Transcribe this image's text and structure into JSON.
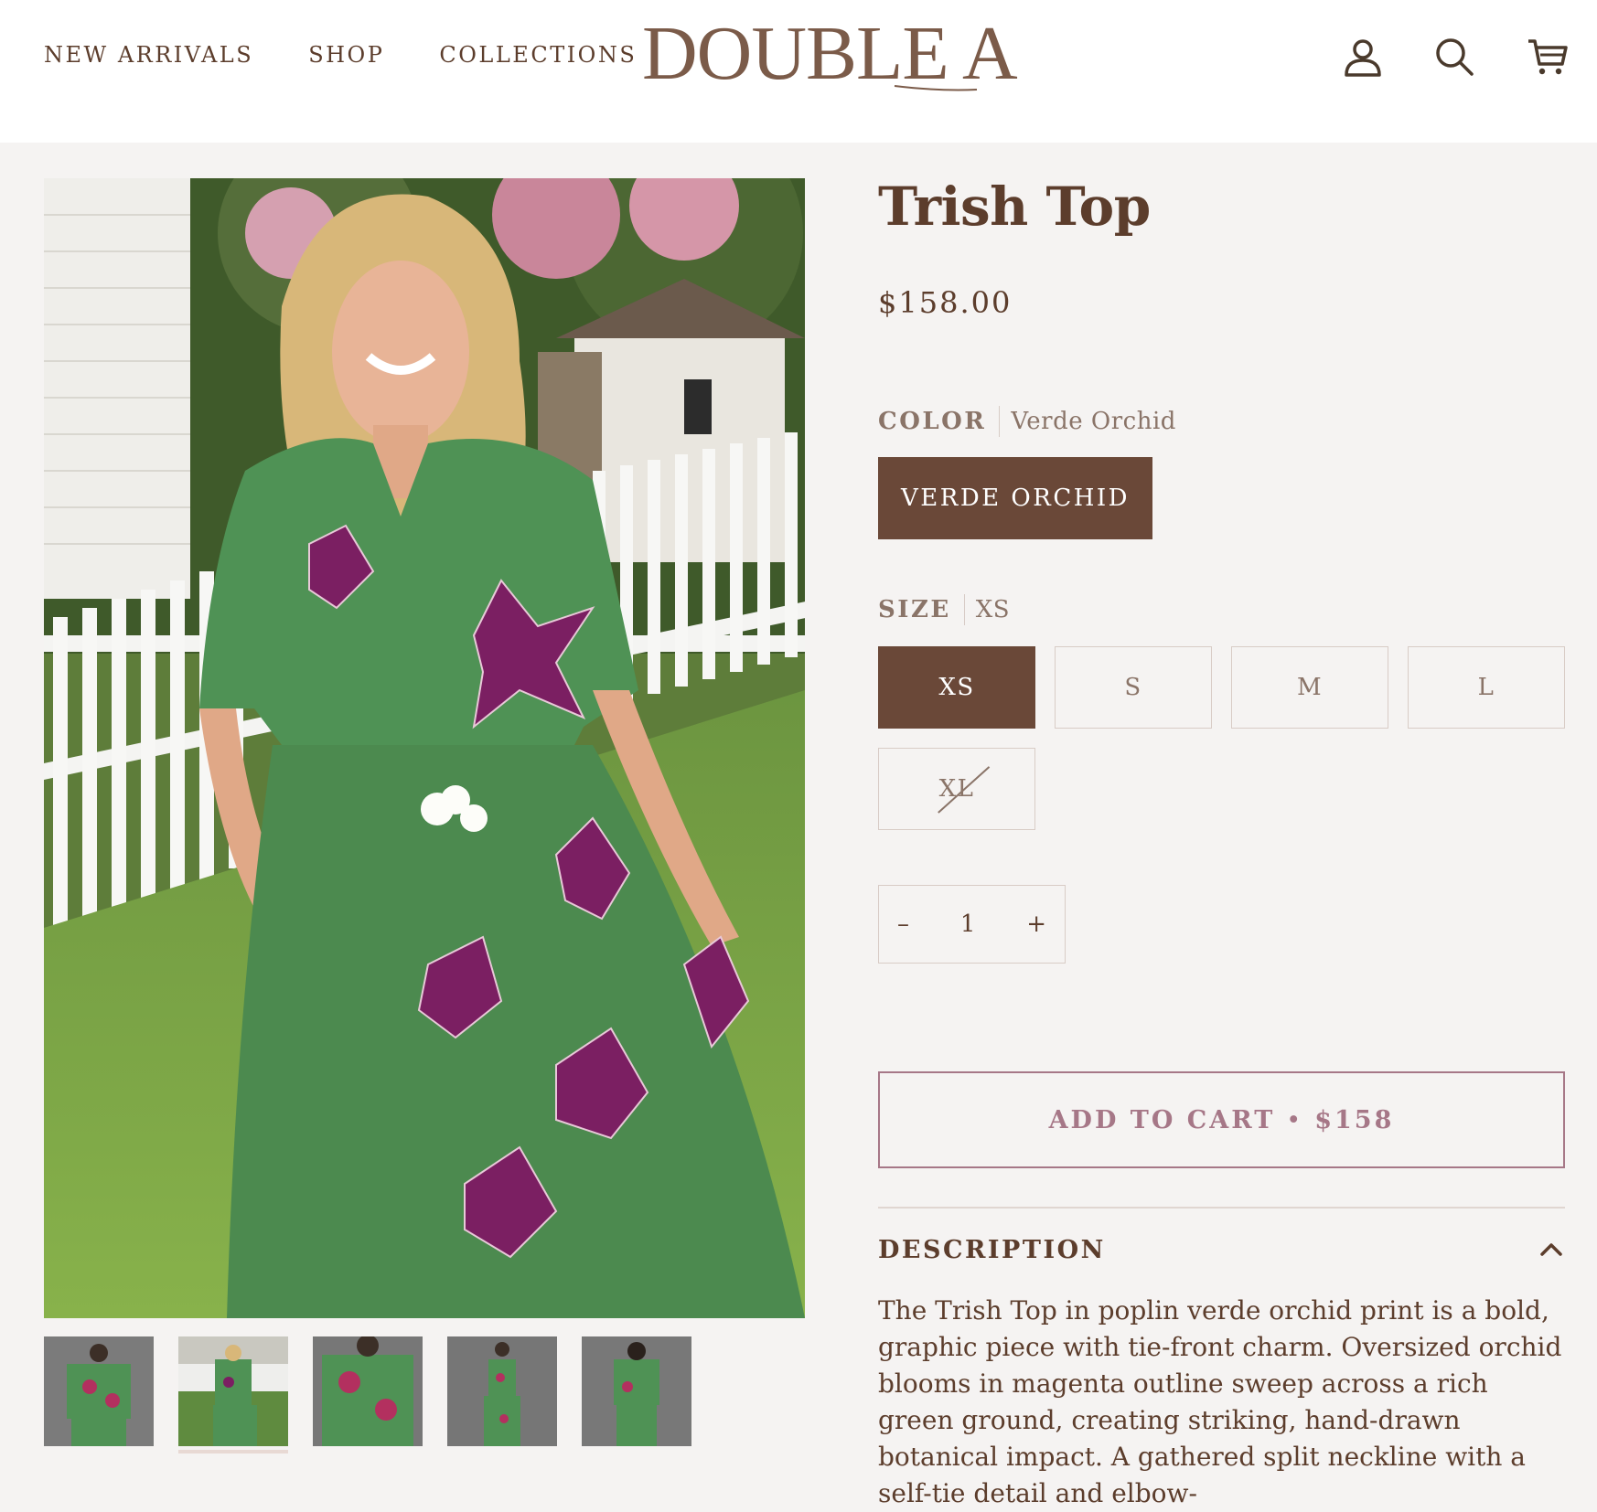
{
  "header": {
    "nav": [
      "NEW ARRIVALS",
      "SHOP",
      "COLLECTIONS"
    ],
    "logo": "DOUBLE A",
    "icons": [
      "account-icon",
      "search-icon",
      "cart-icon"
    ]
  },
  "product": {
    "title": "Trish Top",
    "price": "$158.00",
    "color_label": "COLOR",
    "color_value": "Verde Orchid",
    "color_options": [
      "VERDE ORCHID"
    ],
    "size_label": "SIZE",
    "size_value": "XS",
    "sizes": [
      "XS",
      "S",
      "M",
      "L",
      "XL"
    ],
    "selected_size": "XS",
    "sold_out_sizes": [
      "XL"
    ],
    "quantity": {
      "minus": "–",
      "value": "1",
      "plus": "+"
    },
    "add_to_cart": {
      "label": "ADD TO CART",
      "separator": "•",
      "price": "$158"
    },
    "description_heading": "DESCRIPTION",
    "description_text": "The Trish Top in poplin verde orchid print is a bold, graphic piece with tie-front charm. Oversized orchid blooms in magenta outline sweep across a rich green ground, creating striking, hand-drawn botanical impact. A gathered split neckline with a self-tie detail and elbow-"
  },
  "gallery": {
    "thumbnail_count": 5,
    "active_thumbnail": 2
  },
  "colors": {
    "brand_brown": "#6a4838",
    "text_brown": "#5c3d2c",
    "muted": "#8a7468",
    "accent_rose": "#a67787",
    "background": "#f5f3f2"
  }
}
